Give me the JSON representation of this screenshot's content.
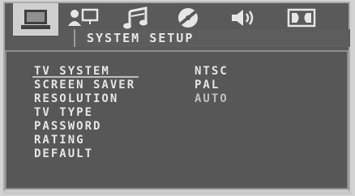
{
  "tabs": [
    {
      "icon": "tv-monitor-icon",
      "active": true
    },
    {
      "icon": "speaker-user-icon",
      "active": false
    },
    {
      "icon": "music-notes-icon",
      "active": false
    },
    {
      "icon": "disc-icon",
      "active": false
    },
    {
      "icon": "speaker-volume-icon",
      "active": false
    },
    {
      "icon": "dolby-icon",
      "active": false
    }
  ],
  "header": {
    "title": "SYSTEM SETUP"
  },
  "menu": {
    "items": [
      {
        "label": "TV SYSTEM"
      },
      {
        "label": "SCREEN SAVER"
      },
      {
        "label": "RESOLUTION"
      },
      {
        "label": "TV TYPE"
      },
      {
        "label": "PASSWORD"
      },
      {
        "label": "RATING"
      },
      {
        "label": "DEFAULT"
      }
    ],
    "selected_index": 0
  },
  "options": {
    "items": [
      {
        "label": "NTSC"
      },
      {
        "label": "PAL"
      },
      {
        "label": "AUTO"
      }
    ]
  },
  "colors": {
    "panel": "#575757",
    "active_tab": "#d0d0d0",
    "text": "#e5e5e5"
  }
}
